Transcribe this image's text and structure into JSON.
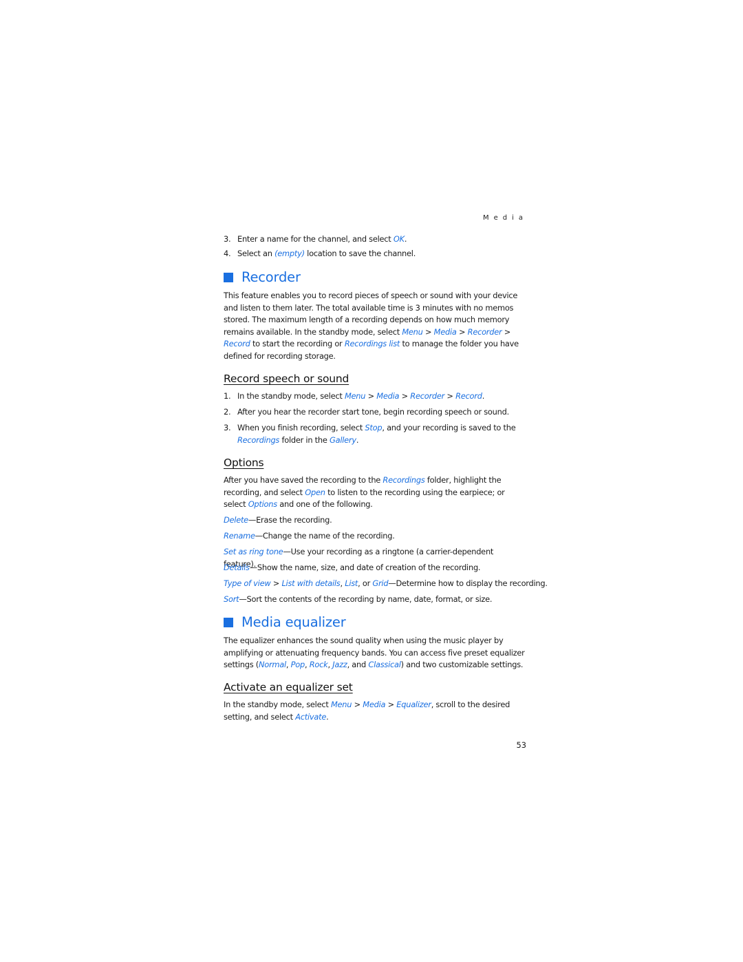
{
  "header": {
    "running_head": "Media"
  },
  "intro_steps": [
    {
      "num": "3.",
      "before": "Enter a name for the channel, and select ",
      "link": "OK",
      "after": "."
    },
    {
      "num": "4.",
      "before": "Select an ",
      "link": "(empty)",
      "after": " location to save the channel."
    }
  ],
  "recorder": {
    "title": "Recorder",
    "body_1": "This feature enables you to record pieces of speech or sound with your device and listen to them later. The total available time is 3 minutes with no memos stored. The maximum length of a recording depends on how much memory remains available. In the standby mode, select ",
    "link_menu": "Menu",
    "sep": " > ",
    "link_media": "Media",
    "link_recorder": "Recorder",
    "link_record": "Record",
    "body_2": " to start the recording or ",
    "link_recordings_list": "Recordings list",
    "body_3": " to manage the folder you have defined for recording storage."
  },
  "record_speech": {
    "title": "Record speech or sound",
    "step1": {
      "num": "1.",
      "before": "In the standby mode, select ",
      "menu": "Menu",
      "media": "Media",
      "recorder": "Recorder",
      "record": "Record",
      "after": "."
    },
    "step2": {
      "num": "2.",
      "text": "After you hear the recorder start tone, begin recording speech or sound."
    },
    "step3": {
      "num": "3.",
      "before": "When you finish recording, select ",
      "stop": "Stop",
      "mid": ", and your recording is saved to the ",
      "recordings": "Recordings",
      "mid2": " folder in the ",
      "gallery": "Gallery",
      "after": "."
    }
  },
  "options": {
    "title": "Options",
    "intro_1": "After you have saved the recording to the ",
    "intro_recordings": "Recordings",
    "intro_2": " folder, highlight the recording, and select ",
    "intro_open": "Open",
    "intro_3": " to listen to the recording using the earpiece; or select ",
    "intro_options": "Options",
    "intro_4": " and one of the following.",
    "items": [
      {
        "term": "Delete",
        "desc": "—Erase the recording."
      },
      {
        "term": "Rename",
        "desc": "—Change the name of the recording."
      },
      {
        "term": "Set as ring tone",
        "desc": "—Use your recording as a ringtone (a carrier-dependent feature)."
      },
      {
        "term": "Details",
        "desc": "—Show the name, size, and date of creation of the recording."
      }
    ],
    "type_of_view": {
      "term": "Type of view",
      "sep": " > ",
      "opt1": "List with details",
      "c1": ", ",
      "opt2": "List",
      "c2": ", or ",
      "opt3": "Grid",
      "desc": "—Determine how to display the recording."
    },
    "sort": {
      "term": "Sort",
      "desc": "—Sort the contents of the recording by name, date, format, or size."
    }
  },
  "equalizer": {
    "title": "Media equalizer",
    "body_1": "The equalizer enhances the sound quality when using the music player by amplifying or attenuating frequency bands. You can access five preset equalizer settings (",
    "normal": "Normal",
    "pop": "Pop",
    "rock": "Rock",
    "jazz": "Jazz",
    "classical": "Classical",
    "comma": ", ",
    "and": ", and ",
    "body_2": ") and two customizable settings."
  },
  "activate": {
    "title": "Activate an equalizer set",
    "before": "In the standby mode, select ",
    "menu": "Menu",
    "sep": " > ",
    "media": "Media",
    "equalizer": "Equalizer",
    "mid": ", scroll to the desired setting, and select ",
    "activate": "Activate",
    "after": "."
  },
  "footer": {
    "page_number": "53"
  }
}
